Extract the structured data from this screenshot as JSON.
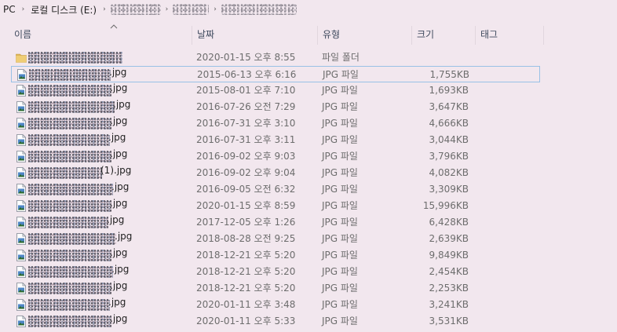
{
  "breadcrumb": {
    "pc": "PC",
    "drive": "로컬 디스크 (E:)",
    "separator": "›"
  },
  "columns": {
    "name": "이름",
    "date": "날짜",
    "type": "유형",
    "size": "크기",
    "tags": "태그"
  },
  "files": [
    {
      "suffix": "",
      "date": "2020-01-15 오후 8:55",
      "type": "파일 폴더",
      "size": "",
      "icon": "folder-icon"
    },
    {
      "suffix": ".jpg",
      "date": "2015-06-13 오후 6:16",
      "type": "JPG 파일",
      "size": "1,755KB",
      "icon": "image-file-icon"
    },
    {
      "suffix": ".jpg",
      "date": "2015-08-01 오후 7:10",
      "type": "JPG 파일",
      "size": "1,693KB",
      "icon": "image-file-icon"
    },
    {
      "suffix": ".jpg",
      "date": "2016-07-26 오전 7:29",
      "type": "JPG 파일",
      "size": "3,647KB",
      "icon": "image-file-icon"
    },
    {
      "suffix": ".jpg",
      "date": "2016-07-31 오후 3:10",
      "type": "JPG 파일",
      "size": "4,666KB",
      "icon": "image-file-icon"
    },
    {
      "suffix": ".jpg",
      "date": "2016-07-31 오후 3:11",
      "type": "JPG 파일",
      "size": "3,044KB",
      "icon": "image-file-icon"
    },
    {
      "suffix": ".jpg",
      "date": "2016-09-02 오후 9:03",
      "type": "JPG 파일",
      "size": "3,796KB",
      "icon": "image-file-icon"
    },
    {
      "suffix": "(1).jpg",
      "date": "2016-09-02 오후 9:04",
      "type": "JPG 파일",
      "size": "4,082KB",
      "icon": "image-file-icon"
    },
    {
      "suffix": ".jpg",
      "date": "2016-09-05 오전 6:32",
      "type": "JPG 파일",
      "size": "3,309KB",
      "icon": "image-file-icon"
    },
    {
      "suffix": ".jpg",
      "date": "2020-01-15 오후 8:59",
      "type": "JPG 파일",
      "size": "15,996KB",
      "icon": "image-file-icon"
    },
    {
      "suffix": ".jpg",
      "date": "2017-12-05 오후 1:26",
      "type": "JPG 파일",
      "size": "6,428KB",
      "icon": "image-file-icon"
    },
    {
      "suffix": ".jpg",
      "date": "2018-08-28 오전 9:25",
      "type": "JPG 파일",
      "size": "2,639KB",
      "icon": "image-file-icon"
    },
    {
      "suffix": ".jpg",
      "date": "2018-12-21 오후 5:20",
      "type": "JPG 파일",
      "size": "9,849KB",
      "icon": "image-file-icon"
    },
    {
      "suffix": ".jpg",
      "date": "2018-12-21 오후 5:20",
      "type": "JPG 파일",
      "size": "2,454KB",
      "icon": "image-file-icon"
    },
    {
      "suffix": ".jpg",
      "date": "2018-12-21 오후 5:20",
      "type": "JPG 파일",
      "size": "2,253KB",
      "icon": "image-file-icon"
    },
    {
      "suffix": ".jpg",
      "date": "2020-01-11 오후 3:48",
      "type": "JPG 파일",
      "size": "3,241KB",
      "icon": "image-file-icon"
    },
    {
      "suffix": ".jpg",
      "date": "2020-01-11 오후 5:33",
      "type": "JPG 파일",
      "size": "3,531KB",
      "icon": "image-file-icon"
    }
  ],
  "focused_index": 1,
  "colors": {
    "background": "#f2e7ee",
    "focus_border": "#99c1e6",
    "folder": "#dcb45a",
    "header_text": "#3f4a5e",
    "detail_text": "#6d6d6d"
  }
}
